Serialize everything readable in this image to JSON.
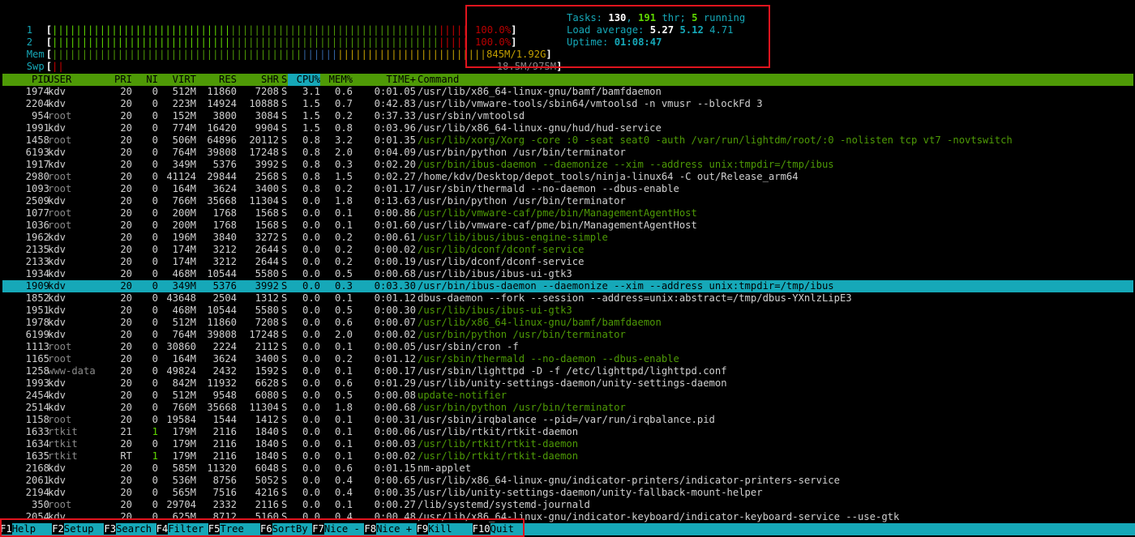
{
  "meters": {
    "cpu1": {
      "label": "1",
      "value": "100.0%"
    },
    "cpu2": {
      "label": "2",
      "value": "100.0%"
    },
    "mem": {
      "label": "Mem",
      "value": "845M/1.92G"
    },
    "swp": {
      "label": "Swp",
      "value": "18.5M/975M"
    }
  },
  "stats": {
    "tasks_label": "Tasks:",
    "tasks": "130",
    "thr": "191",
    "thr_label": "thr;",
    "running": "5",
    "running_label": "running",
    "load_label": "Load average:",
    "load1": "5.27",
    "load5": "5.12",
    "load15": "4.71",
    "uptime_label": "Uptime:",
    "uptime": "01:08:47"
  },
  "columns": [
    "PID",
    "USER",
    "PRI",
    "NI",
    "VIRT",
    "RES",
    "SHR",
    "S",
    "CPU%",
    "MEM%",
    "TIME+",
    "Command"
  ],
  "processes": [
    {
      "pid": "1974",
      "user": "kdv",
      "pri": "20",
      "ni": "0",
      "virt": "512M",
      "res": "11860",
      "shr": "7208",
      "s": "S",
      "cpu": "3.1",
      "mem": "0.6",
      "time": "0:01.05",
      "cmd": "/usr/lib/x86_64-linux-gnu/bamf/bamfdaemon",
      "thread": false
    },
    {
      "pid": "2204",
      "user": "kdv",
      "pri": "20",
      "ni": "0",
      "virt": "223M",
      "res": "14924",
      "shr": "10888",
      "s": "S",
      "cpu": "1.5",
      "mem": "0.7",
      "time": "0:42.83",
      "cmd": "/usr/lib/vmware-tools/sbin64/vmtoolsd -n vmusr --blockFd 3",
      "thread": false
    },
    {
      "pid": "954",
      "user": "root",
      "pri": "20",
      "ni": "0",
      "virt": "152M",
      "res": "3800",
      "shr": "3084",
      "s": "S",
      "cpu": "1.5",
      "mem": "0.2",
      "time": "0:37.33",
      "cmd": "/usr/sbin/vmtoolsd",
      "thread": false
    },
    {
      "pid": "1991",
      "user": "kdv",
      "pri": "20",
      "ni": "0",
      "virt": "774M",
      "res": "16420",
      "shr": "9904",
      "s": "S",
      "cpu": "1.5",
      "mem": "0.8",
      "time": "0:03.96",
      "cmd": "/usr/lib/x86_64-linux-gnu/hud/hud-service",
      "thread": false
    },
    {
      "pid": "1458",
      "user": "root",
      "pri": "20",
      "ni": "0",
      "virt": "506M",
      "res": "64896",
      "shr": "20112",
      "s": "S",
      "cpu": "0.8",
      "mem": "3.2",
      "time": "0:01.35",
      "cmd": "/usr/lib/xorg/Xorg -core :0 -seat seat0 -auth /var/run/lightdm/root/:0 -nolisten tcp vt7 -novtswitch",
      "thread": true
    },
    {
      "pid": "6193",
      "user": "kdv",
      "pri": "20",
      "ni": "0",
      "virt": "764M",
      "res": "39808",
      "shr": "17248",
      "s": "S",
      "cpu": "0.8",
      "mem": "2.0",
      "time": "0:04.09",
      "cmd": "/usr/bin/python /usr/bin/terminator",
      "thread": false
    },
    {
      "pid": "1917",
      "user": "kdv",
      "pri": "20",
      "ni": "0",
      "virt": "349M",
      "res": "5376",
      "shr": "3992",
      "s": "S",
      "cpu": "0.8",
      "mem": "0.3",
      "time": "0:02.20",
      "cmd": "/usr/bin/ibus-daemon --daemonize --xim --address unix:tmpdir=/tmp/ibus",
      "thread": true
    },
    {
      "pid": "2980",
      "user": "root",
      "pri": "20",
      "ni": "0",
      "virt": "41124",
      "res": "29844",
      "shr": "2568",
      "s": "S",
      "cpu": "0.8",
      "mem": "1.5",
      "time": "0:02.27",
      "cmd": "/home/kdv/Desktop/depot_tools/ninja-linux64 -C out/Release_arm64",
      "thread": false
    },
    {
      "pid": "1093",
      "user": "root",
      "pri": "20",
      "ni": "0",
      "virt": "164M",
      "res": "3624",
      "shr": "3400",
      "s": "S",
      "cpu": "0.8",
      "mem": "0.2",
      "time": "0:01.17",
      "cmd": "/usr/sbin/thermald --no-daemon --dbus-enable",
      "thread": false
    },
    {
      "pid": "2509",
      "user": "kdv",
      "pri": "20",
      "ni": "0",
      "virt": "766M",
      "res": "35668",
      "shr": "11304",
      "s": "S",
      "cpu": "0.0",
      "mem": "1.8",
      "time": "0:13.63",
      "cmd": "/usr/bin/python /usr/bin/terminator",
      "thread": false
    },
    {
      "pid": "1077",
      "user": "root",
      "pri": "20",
      "ni": "0",
      "virt": "200M",
      "res": "1768",
      "shr": "1568",
      "s": "S",
      "cpu": "0.0",
      "mem": "0.1",
      "time": "0:00.86",
      "cmd": "/usr/lib/vmware-caf/pme/bin/ManagementAgentHost",
      "thread": true
    },
    {
      "pid": "1036",
      "user": "root",
      "pri": "20",
      "ni": "0",
      "virt": "200M",
      "res": "1768",
      "shr": "1568",
      "s": "S",
      "cpu": "0.0",
      "mem": "0.1",
      "time": "0:01.60",
      "cmd": "/usr/lib/vmware-caf/pme/bin/ManagementAgentHost",
      "thread": false
    },
    {
      "pid": "1962",
      "user": "kdv",
      "pri": "20",
      "ni": "0",
      "virt": "196M",
      "res": "3840",
      "shr": "3272",
      "s": "S",
      "cpu": "0.0",
      "mem": "0.2",
      "time": "0:00.61",
      "cmd": "/usr/lib/ibus/ibus-engine-simple",
      "thread": true
    },
    {
      "pid": "2135",
      "user": "kdv",
      "pri": "20",
      "ni": "0",
      "virt": "174M",
      "res": "3212",
      "shr": "2644",
      "s": "S",
      "cpu": "0.0",
      "mem": "0.2",
      "time": "0:00.02",
      "cmd": "/usr/lib/dconf/dconf-service",
      "thread": true
    },
    {
      "pid": "2133",
      "user": "kdv",
      "pri": "20",
      "ni": "0",
      "virt": "174M",
      "res": "3212",
      "shr": "2644",
      "s": "S",
      "cpu": "0.0",
      "mem": "0.2",
      "time": "0:00.19",
      "cmd": "/usr/lib/dconf/dconf-service",
      "thread": false
    },
    {
      "pid": "1934",
      "user": "kdv",
      "pri": "20",
      "ni": "0",
      "virt": "468M",
      "res": "10544",
      "shr": "5580",
      "s": "S",
      "cpu": "0.0",
      "mem": "0.5",
      "time": "0:00.68",
      "cmd": "/usr/lib/ibus/ibus-ui-gtk3",
      "thread": false
    },
    {
      "pid": "1909",
      "user": "kdv",
      "pri": "20",
      "ni": "0",
      "virt": "349M",
      "res": "5376",
      "shr": "3992",
      "s": "S",
      "cpu": "0.0",
      "mem": "0.3",
      "time": "0:03.30",
      "cmd": "/usr/bin/ibus-daemon --daemonize --xim --address unix:tmpdir=/tmp/ibus",
      "thread": false,
      "selected": true
    },
    {
      "pid": "1852",
      "user": "kdv",
      "pri": "20",
      "ni": "0",
      "virt": "43648",
      "res": "2504",
      "shr": "1312",
      "s": "S",
      "cpu": "0.0",
      "mem": "0.1",
      "time": "0:01.12",
      "cmd": "dbus-daemon --fork --session --address=unix:abstract=/tmp/dbus-YXnlzLipE3",
      "thread": false
    },
    {
      "pid": "1951",
      "user": "kdv",
      "pri": "20",
      "ni": "0",
      "virt": "468M",
      "res": "10544",
      "shr": "5580",
      "s": "S",
      "cpu": "0.0",
      "mem": "0.5",
      "time": "0:00.30",
      "cmd": "/usr/lib/ibus/ibus-ui-gtk3",
      "thread": true
    },
    {
      "pid": "1978",
      "user": "kdv",
      "pri": "20",
      "ni": "0",
      "virt": "512M",
      "res": "11860",
      "shr": "7208",
      "s": "S",
      "cpu": "0.0",
      "mem": "0.6",
      "time": "0:00.07",
      "cmd": "/usr/lib/x86_64-linux-gnu/bamf/bamfdaemon",
      "thread": true
    },
    {
      "pid": "6199",
      "user": "kdv",
      "pri": "20",
      "ni": "0",
      "virt": "764M",
      "res": "39808",
      "shr": "17248",
      "s": "S",
      "cpu": "0.0",
      "mem": "2.0",
      "time": "0:00.02",
      "cmd": "/usr/bin/python /usr/bin/terminator",
      "thread": true
    },
    {
      "pid": "1113",
      "user": "root",
      "pri": "20",
      "ni": "0",
      "virt": "30860",
      "res": "2224",
      "shr": "2112",
      "s": "S",
      "cpu": "0.0",
      "mem": "0.1",
      "time": "0:00.05",
      "cmd": "/usr/sbin/cron -f",
      "thread": false
    },
    {
      "pid": "1165",
      "user": "root",
      "pri": "20",
      "ni": "0",
      "virt": "164M",
      "res": "3624",
      "shr": "3400",
      "s": "S",
      "cpu": "0.0",
      "mem": "0.2",
      "time": "0:01.12",
      "cmd": "/usr/sbin/thermald --no-daemon --dbus-enable",
      "thread": true
    },
    {
      "pid": "1258",
      "user": "www-data",
      "pri": "20",
      "ni": "0",
      "virt": "49824",
      "res": "2432",
      "shr": "1592",
      "s": "S",
      "cpu": "0.0",
      "mem": "0.1",
      "time": "0:00.17",
      "cmd": "/usr/sbin/lighttpd -D -f /etc/lighttpd/lighttpd.conf",
      "thread": false
    },
    {
      "pid": "1993",
      "user": "kdv",
      "pri": "20",
      "ni": "0",
      "virt": "842M",
      "res": "11932",
      "shr": "6628",
      "s": "S",
      "cpu": "0.0",
      "mem": "0.6",
      "time": "0:01.29",
      "cmd": "/usr/lib/unity-settings-daemon/unity-settings-daemon",
      "thread": false
    },
    {
      "pid": "2454",
      "user": "kdv",
      "pri": "20",
      "ni": "0",
      "virt": "512M",
      "res": "9548",
      "shr": "6080",
      "s": "S",
      "cpu": "0.0",
      "mem": "0.5",
      "time": "0:00.08",
      "cmd": "update-notifier",
      "thread": true
    },
    {
      "pid": "2514",
      "user": "kdv",
      "pri": "20",
      "ni": "0",
      "virt": "766M",
      "res": "35668",
      "shr": "11304",
      "s": "S",
      "cpu": "0.0",
      "mem": "1.8",
      "time": "0:00.68",
      "cmd": "/usr/bin/python /usr/bin/terminator",
      "thread": true
    },
    {
      "pid": "1158",
      "user": "root",
      "pri": "20",
      "ni": "0",
      "virt": "19584",
      "res": "1544",
      "shr": "1412",
      "s": "S",
      "cpu": "0.0",
      "mem": "0.1",
      "time": "0:00.31",
      "cmd": "/usr/sbin/irqbalance --pid=/var/run/irqbalance.pid",
      "thread": false
    },
    {
      "pid": "1633",
      "user": "rtkit",
      "pri": "21",
      "ni": "1",
      "virt": "179M",
      "res": "2116",
      "shr": "1840",
      "s": "S",
      "cpu": "0.0",
      "mem": "0.1",
      "time": "0:00.06",
      "cmd": "/usr/lib/rtkit/rtkit-daemon",
      "thread": false
    },
    {
      "pid": "1634",
      "user": "rtkit",
      "pri": "20",
      "ni": "0",
      "virt": "179M",
      "res": "2116",
      "shr": "1840",
      "s": "S",
      "cpu": "0.0",
      "mem": "0.1",
      "time": "0:00.03",
      "cmd": "/usr/lib/rtkit/rtkit-daemon",
      "thread": true
    },
    {
      "pid": "1635",
      "user": "rtkit",
      "pri": "RT",
      "ni": "1",
      "virt": "179M",
      "res": "2116",
      "shr": "1840",
      "s": "S",
      "cpu": "0.0",
      "mem": "0.1",
      "time": "0:00.02",
      "cmd": "/usr/lib/rtkit/rtkit-daemon",
      "thread": true
    },
    {
      "pid": "2168",
      "user": "kdv",
      "pri": "20",
      "ni": "0",
      "virt": "585M",
      "res": "11320",
      "shr": "6048",
      "s": "S",
      "cpu": "0.0",
      "mem": "0.6",
      "time": "0:01.15",
      "cmd": "nm-applet",
      "thread": false
    },
    {
      "pid": "2061",
      "user": "kdv",
      "pri": "20",
      "ni": "0",
      "virt": "536M",
      "res": "8756",
      "shr": "5052",
      "s": "S",
      "cpu": "0.0",
      "mem": "0.4",
      "time": "0:00.65",
      "cmd": "/usr/lib/x86_64-linux-gnu/indicator-printers/indicator-printers-service",
      "thread": false
    },
    {
      "pid": "2194",
      "user": "kdv",
      "pri": "20",
      "ni": "0",
      "virt": "565M",
      "res": "7516",
      "shr": "4216",
      "s": "S",
      "cpu": "0.0",
      "mem": "0.4",
      "time": "0:00.35",
      "cmd": "/usr/lib/unity-settings-daemon/unity-fallback-mount-helper",
      "thread": false
    },
    {
      "pid": "350",
      "user": "root",
      "pri": "20",
      "ni": "0",
      "virt": "29704",
      "res": "2332",
      "shr": "2116",
      "s": "S",
      "cpu": "0.0",
      "mem": "0.1",
      "time": "0:00.27",
      "cmd": "/lib/systemd/systemd-journald",
      "thread": false
    },
    {
      "pid": "2054",
      "user": "kdv",
      "pri": "20",
      "ni": "0",
      "virt": "625M",
      "res": "8712",
      "shr": "5160",
      "s": "S",
      "cpu": "0.0",
      "mem": "0.4",
      "time": "0:00.48",
      "cmd": "/usr/lib/x86_64-linux-gnu/indicator-keyboard/indicator-keyboard-service --use-gtk",
      "thread": false
    }
  ],
  "footer": [
    {
      "key": "F1",
      "label": "Help"
    },
    {
      "key": "F2",
      "label": "Setup"
    },
    {
      "key": "F3",
      "label": "Search"
    },
    {
      "key": "F4",
      "label": "Filter"
    },
    {
      "key": "F5",
      "label": "Tree"
    },
    {
      "key": "F6",
      "label": "SortBy"
    },
    {
      "key": "F7",
      "label": "Nice -"
    },
    {
      "key": "F8",
      "label": "Nice +"
    },
    {
      "key": "F9",
      "label": "Kill"
    },
    {
      "key": "F10",
      "label": "Quit"
    }
  ],
  "colors": {
    "accent": "#16a8b8",
    "header": "#4e9a06",
    "highlight_box": "#e0141e"
  }
}
